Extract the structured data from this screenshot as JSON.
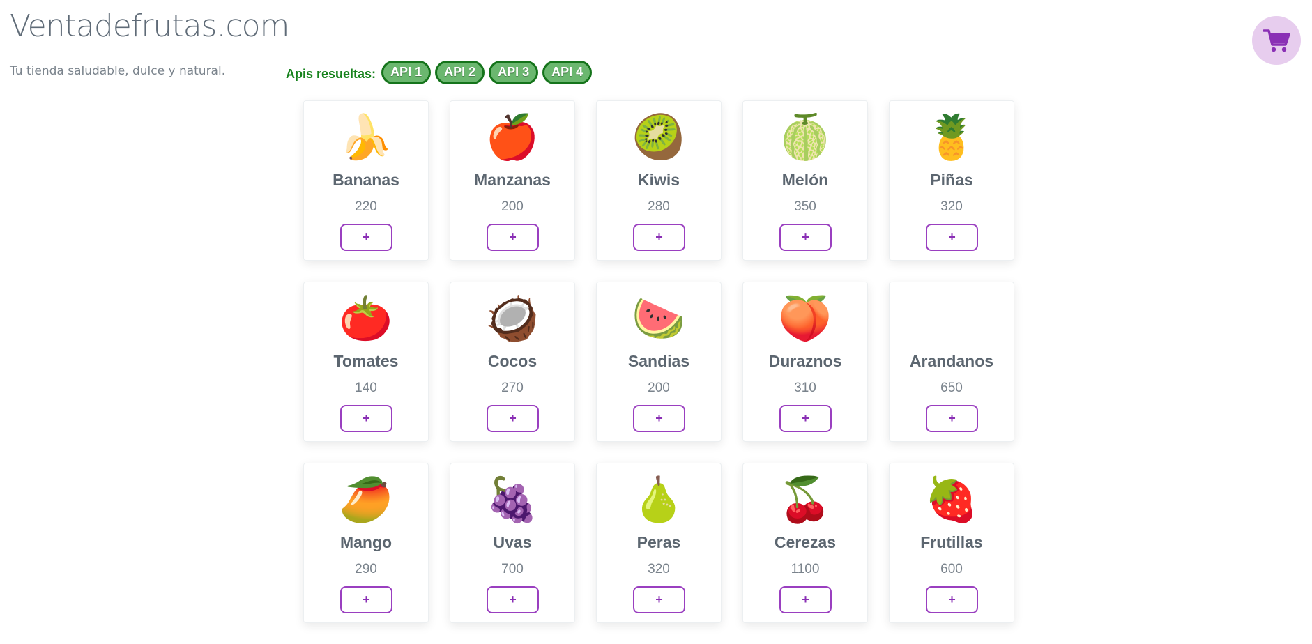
{
  "header": {
    "title": "Ventadefrutas.com",
    "tagline": "Tu tienda saludable, dulce y natural."
  },
  "apis": {
    "label": "Apis resueltas:",
    "badges": [
      "API 1",
      "API 2",
      "API 3",
      "API 4"
    ]
  },
  "cart": {
    "icon": "shopping-cart-icon",
    "color": "#8a2fb5"
  },
  "colors": {
    "accent": "#8a2fb5",
    "api_green": "#17821d",
    "api_fill": "#6bb76f"
  },
  "add_label": "+",
  "products": [
    {
      "name": "Bananas",
      "price": "220",
      "emoji": "🍌",
      "icon": "banana-icon"
    },
    {
      "name": "Manzanas",
      "price": "200",
      "emoji": "🍎",
      "icon": "apple-icon"
    },
    {
      "name": "Kiwis",
      "price": "280",
      "emoji": "🥝",
      "icon": "kiwi-icon"
    },
    {
      "name": "Melón",
      "price": "350",
      "emoji": "🍈",
      "icon": "melon-icon"
    },
    {
      "name": "Piñas",
      "price": "320",
      "emoji": "🍍",
      "icon": "pineapple-icon"
    },
    {
      "name": "Tomates",
      "price": "140",
      "emoji": "🍅",
      "icon": "tomato-icon"
    },
    {
      "name": "Cocos",
      "price": "270",
      "emoji": "🥥",
      "icon": "coconut-icon"
    },
    {
      "name": "Sandias",
      "price": "200",
      "emoji": "🍉",
      "icon": "watermelon-icon"
    },
    {
      "name": "Duraznos",
      "price": "310",
      "emoji": "🍑",
      "icon": "peach-icon"
    },
    {
      "name": "Arandanos",
      "price": "650",
      "emoji": "",
      "icon": "missing-glyph-icon"
    },
    {
      "name": "Mango",
      "price": "290",
      "emoji": "🥭",
      "icon": "mango-icon"
    },
    {
      "name": "Uvas",
      "price": "700",
      "emoji": "🍇",
      "icon": "grapes-icon"
    },
    {
      "name": "Peras",
      "price": "320",
      "emoji": "🍐",
      "icon": "pear-icon"
    },
    {
      "name": "Cerezas",
      "price": "1100",
      "emoji": "🍒",
      "icon": "cherries-icon"
    },
    {
      "name": "Frutillas",
      "price": "600",
      "emoji": "🍓",
      "icon": "strawberry-icon"
    }
  ]
}
